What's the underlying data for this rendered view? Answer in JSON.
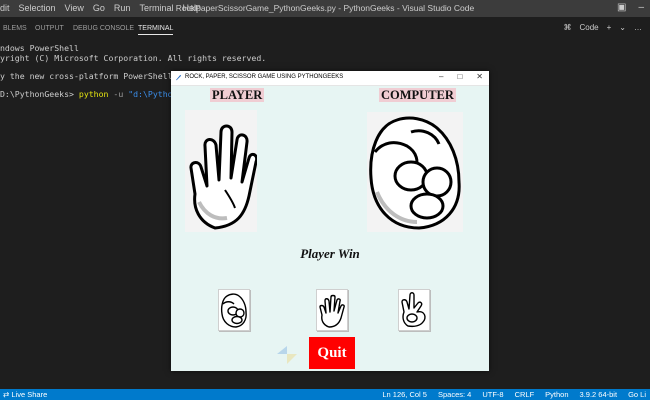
{
  "vscode": {
    "menu": [
      "dit",
      "Selection",
      "View",
      "Go",
      "Run",
      "Terminal",
      "Help"
    ],
    "window_title": "RockPaperScissorGame_PythonGeeks.py - PythonGeeks - Visual Studio Code",
    "panel_tabs": [
      "BLEMS",
      "OUTPUT",
      "DEBUG CONSOLE",
      "TERMINAL"
    ],
    "active_tab": "TERMINAL",
    "shell_label": "Code",
    "terminal": {
      "line1": "ndows PowerShell",
      "line2": "yright (C) Microsoft Corporation. All rights reserved.",
      "line3": "y the new cross-platform PowerShell http",
      "prompt": "D:\\PythonGeeks>",
      "cmd": "python",
      "flag": "-u",
      "path": "\"d:\\PythonGee"
    },
    "status": {
      "live_share": "Live Share",
      "ln_col": "Ln 126, Col 5",
      "spaces": "Spaces: 4",
      "encoding": "UTF-8",
      "eol": "CRLF",
      "language": "Python",
      "interpreter": "3.9.2 64-bit",
      "golive": "Go Li"
    }
  },
  "game": {
    "window_title": "ROCK, PAPER, SCISSOR GAME USING PYTHONGEEKS",
    "player_label": "PLAYER",
    "computer_label": "COMPUTER",
    "player_choice_icon": "paper-hand",
    "computer_choice_icon": "rock-fist",
    "result": "Player Win",
    "quit_label": "Quit",
    "choices": [
      "rock",
      "paper",
      "scissor"
    ],
    "quit_color": "#ff0000",
    "label_bg": "#f0cdd3",
    "body_bg": "#e7f5f3"
  }
}
